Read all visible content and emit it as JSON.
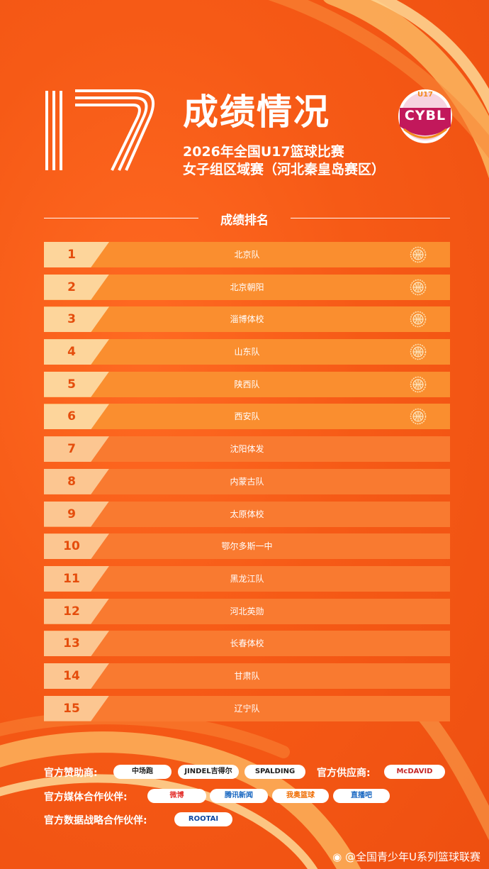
{
  "header": {
    "title": "成绩情况",
    "subtitle_line1": "2026年全国U17篮球比赛",
    "subtitle_line2": "女子组区域赛（河北秦皇岛赛区）",
    "logo_top": "U17",
    "logo_text": "CYBL"
  },
  "section_title": "成绩排名",
  "rankings": [
    {
      "rank": "1",
      "team": "北京队",
      "medal": true
    },
    {
      "rank": "2",
      "team": "北京朝阳",
      "medal": true
    },
    {
      "rank": "3",
      "team": "淄博体校",
      "medal": true
    },
    {
      "rank": "4",
      "team": "山东队",
      "medal": true
    },
    {
      "rank": "5",
      "team": "陕西队",
      "medal": true
    },
    {
      "rank": "6",
      "team": "西安队",
      "medal": true
    },
    {
      "rank": "7",
      "team": "沈阳体发",
      "medal": false
    },
    {
      "rank": "8",
      "team": "内蒙古队",
      "medal": false
    },
    {
      "rank": "9",
      "team": "太原体校",
      "medal": false
    },
    {
      "rank": "10",
      "team": "鄂尔多斯一中",
      "medal": false
    },
    {
      "rank": "11",
      "team": "黑龙江队",
      "medal": false
    },
    {
      "rank": "12",
      "team": "河北英勋",
      "medal": false
    },
    {
      "rank": "13",
      "team": "长春体校",
      "medal": false
    },
    {
      "rank": "14",
      "team": "甘肃队",
      "medal": false
    },
    {
      "rank": "15",
      "team": "辽宁队",
      "medal": false
    }
  ],
  "sponsors": {
    "sponsor_label": "官方赞助商:",
    "sponsor_logos": [
      "中场跑",
      "JINDEL吉得尔",
      "SPALDING"
    ],
    "supplier_label": "官方供应商:",
    "supplier_logos": [
      "McDAVID"
    ],
    "media_label": "官方媒体合作伙伴:",
    "media_logos": [
      "微博",
      "腾讯新闻",
      "我奥篮球",
      "直播吧"
    ],
    "data_label": "官方数据战略合作伙伴:",
    "data_logos": [
      "ROOTAI"
    ]
  },
  "watermark": "@全国青少年U系列篮球联赛",
  "colors": {
    "background": "#f65a16",
    "row": "#f97a30",
    "row_top": "#fa8e2f",
    "rank_pad": "#fcc691",
    "rank_number": "#e54d0c",
    "accent_stripe": "#fbbd6a"
  },
  "icons": {
    "medal": "basketball-medal-icon",
    "weibo": "weibo-icon"
  }
}
